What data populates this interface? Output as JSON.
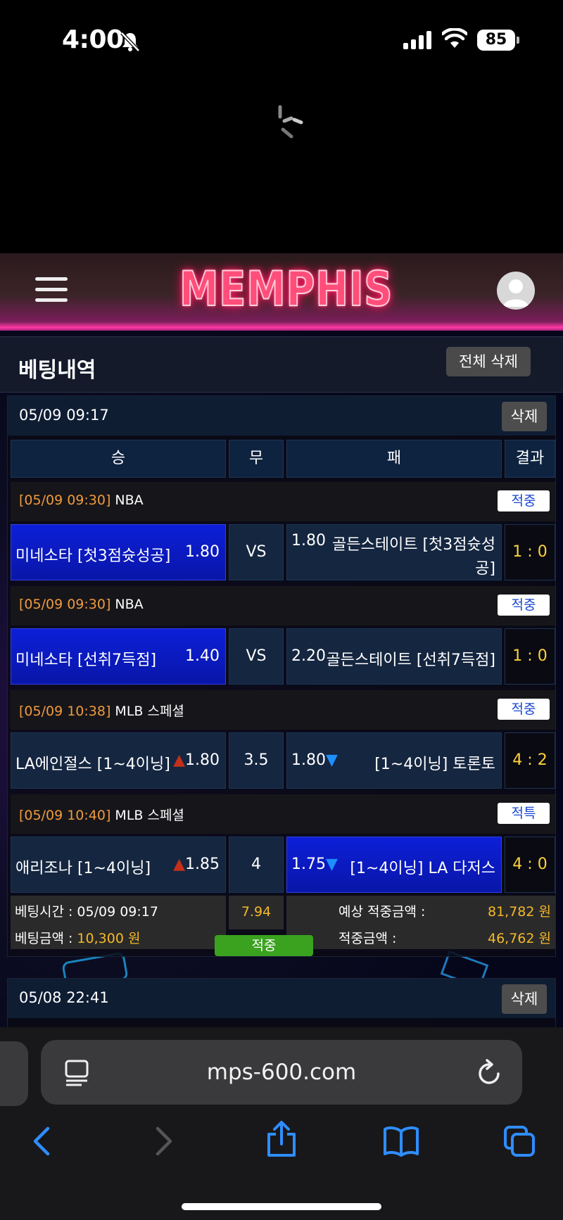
{
  "status_bar": {
    "time": "4:00",
    "battery": "85"
  },
  "header": {
    "logo": "MEMPHIS"
  },
  "page": {
    "title": "베팅내역",
    "delete_all_label": "전체 삭제"
  },
  "columns": {
    "win": "승",
    "draw": "무",
    "lose": "패",
    "result": "결과"
  },
  "bets": [
    {
      "datetime": "05/09 09:17",
      "delete_label": "삭제",
      "games": [
        {
          "time": "[05/09 09:30]",
          "league": "NBA",
          "badge": "적중",
          "home": "미네소타 [첫3점슛성공]",
          "home_odds": "1.80",
          "mid": "VS",
          "away_odds": "1.80",
          "away": "골든스테이트 [첫3점슛성",
          "away_line2": "공]",
          "score": "1 : 0"
        },
        {
          "time": "[05/09 09:30]",
          "league": "NBA",
          "badge": "적중",
          "home": "미네소타 [선취7득점]",
          "home_odds": "1.40",
          "mid": "VS",
          "away_odds": "2.20",
          "away": "골든스테이트 [선취7득점]",
          "score": "1 : 0"
        },
        {
          "time": "[05/09 10:38]",
          "league": "MLB 스페셜",
          "badge": "적중",
          "home": "LA에인절스 [1~4이닝]",
          "home_odds": "1.80",
          "mid": "3.5",
          "away_odds": "1.80",
          "away": "[1~4이닝] 토론토",
          "score": "4 : 2"
        },
        {
          "time": "[05/09 10:40]",
          "league": "MLB 스페셜",
          "badge": "적특",
          "home": "애리조나 [1~4이닝]",
          "home_odds": "1.85",
          "mid": "4",
          "away_odds": "1.75",
          "away": "[1~4이닝] LA 다저스",
          "score": "4 : 0"
        }
      ],
      "summary": {
        "bet_time_label": "베팅시간 : 05/09 09:17",
        "bet_amount_label": "베팅금액 :",
        "bet_amount": "10,300 원",
        "total_odds": "7.94",
        "status": "적중",
        "expected_label": "예상 적중금액 :",
        "expected_amount": "81,782 원",
        "win_label": "적중금액 :",
        "win_amount": "46,762 원"
      }
    },
    {
      "datetime": "05/08 22:41",
      "delete_label": "삭제"
    }
  ],
  "browser": {
    "url": "mps-600.com"
  },
  "icons": [
    "silent-bell-icon",
    "signal-icon",
    "wifi-icon",
    "battery-icon",
    "spinner-icon",
    "menu-icon",
    "user-icon",
    "arrow-up-icon",
    "arrow-down-icon",
    "page-icon",
    "reload-icon",
    "back-icon",
    "forward-icon",
    "share-icon",
    "bookmarks-icon",
    "tabs-icon"
  ]
}
